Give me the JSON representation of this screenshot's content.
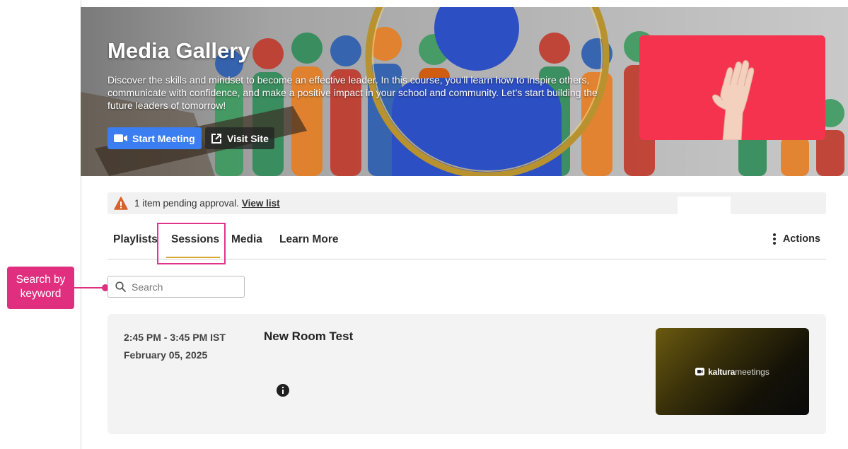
{
  "hero": {
    "title": "Media Gallery",
    "description": "Discover the skills and mindset to become an effective leader. In this course, you’ll learn how to inspire others, communicate with confidence, and make a positive impact in your school and community. Let’s start building the future leaders of tomorrow!",
    "start_meeting_label": "Start Meeting",
    "visit_site_label": "Visit Site"
  },
  "notice": {
    "text": "1 item pending approval.",
    "link_label": "View list"
  },
  "tabs": {
    "items": [
      {
        "label": "Playlists"
      },
      {
        "label": "Sessions"
      },
      {
        "label": "Media"
      },
      {
        "label": "Learn More"
      }
    ],
    "active": "Sessions",
    "actions_label": "Actions"
  },
  "callout": {
    "line1": "Search by",
    "line2": "keyword"
  },
  "search": {
    "placeholder": "Search",
    "value": ""
  },
  "session": {
    "time": "2:45 PM - 3:45 PM IST",
    "date": "February 05, 2025",
    "title": "New Room Test",
    "thumbnail_brand": "kaltura",
    "thumbnail_product": "meetings"
  },
  "colors": {
    "accent_blue": "#3a7ef2",
    "highlight_pink": "#e0338a",
    "tab_underline": "#d8a832",
    "hero_thumb_red": "#f5334e"
  }
}
